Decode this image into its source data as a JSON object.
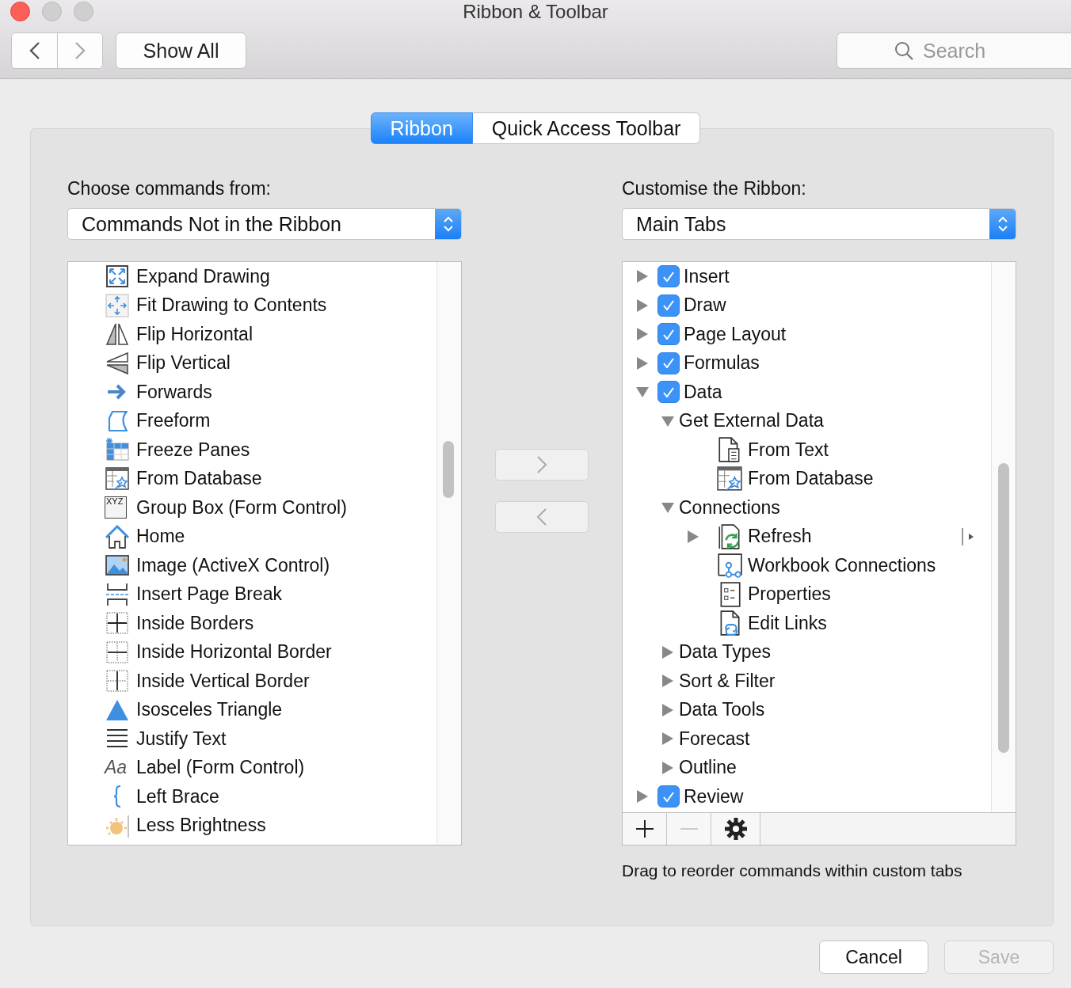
{
  "window": {
    "title": "Ribbon & Toolbar"
  },
  "toolbar": {
    "show_all": "Show All",
    "search": {
      "placeholder": "Search"
    }
  },
  "tabs": [
    {
      "label": "Ribbon",
      "selected": true
    },
    {
      "label": "Quick Access Toolbar",
      "selected": false
    }
  ],
  "left": {
    "label": "Choose commands from:",
    "dropdown": "Commands Not in the Ribbon",
    "items": [
      {
        "label": "Expand Drawing"
      },
      {
        "label": "Fit Drawing to Contents"
      },
      {
        "label": "Flip Horizontal"
      },
      {
        "label": "Flip Vertical"
      },
      {
        "label": "Forwards"
      },
      {
        "label": "Freeform"
      },
      {
        "label": "Freeze Panes"
      },
      {
        "label": "From Database"
      },
      {
        "label": "Group Box (Form Control)",
        "glyph": "XYZ"
      },
      {
        "label": "Home"
      },
      {
        "label": "Image (ActiveX Control)"
      },
      {
        "label": "Insert Page Break"
      },
      {
        "label": "Inside Borders"
      },
      {
        "label": "Inside Horizontal Border"
      },
      {
        "label": "Inside Vertical Border"
      },
      {
        "label": "Isosceles Triangle"
      },
      {
        "label": "Justify Text"
      },
      {
        "label": "Label (Form Control)",
        "glyph": "Aa"
      },
      {
        "label": "Left Brace"
      },
      {
        "label": "Less Brightness"
      }
    ]
  },
  "right": {
    "label": "Customise the Ribbon:",
    "dropdown": "Main Tabs",
    "tree": [
      {
        "kind": "tab",
        "label": "Insert",
        "checked": true,
        "expanded": false
      },
      {
        "kind": "tab",
        "label": "Draw",
        "checked": true,
        "expanded": false
      },
      {
        "kind": "tab",
        "label": "Page Layout",
        "checked": true,
        "expanded": false
      },
      {
        "kind": "tab",
        "label": "Formulas",
        "checked": true,
        "expanded": false
      },
      {
        "kind": "tab",
        "label": "Data",
        "checked": true,
        "expanded": true,
        "children": [
          {
            "kind": "group",
            "label": "Get External Data",
            "expanded": true,
            "children": [
              {
                "kind": "command",
                "label": "From Text"
              },
              {
                "kind": "command",
                "label": "From Database"
              }
            ]
          },
          {
            "kind": "group",
            "label": "Connections",
            "expanded": true,
            "children": [
              {
                "kind": "split",
                "label": "Refresh",
                "expanded": false
              },
              {
                "kind": "command",
                "label": "Workbook Connections"
              },
              {
                "kind": "command",
                "label": "Properties"
              },
              {
                "kind": "command",
                "label": "Edit Links"
              }
            ]
          },
          {
            "kind": "group",
            "label": "Data Types",
            "expanded": false
          },
          {
            "kind": "group",
            "label": "Sort & Filter",
            "expanded": false
          },
          {
            "kind": "group",
            "label": "Data Tools",
            "expanded": false
          },
          {
            "kind": "group",
            "label": "Forecast",
            "expanded": false
          },
          {
            "kind": "group",
            "label": "Outline",
            "expanded": false
          }
        ]
      },
      {
        "kind": "tab",
        "label": "Review",
        "checked": true,
        "expanded": false
      }
    ],
    "remove_disabled": true,
    "hint": "Drag to reorder commands within custom tabs"
  },
  "buttons": [
    {
      "label": "Cancel",
      "disabled": false
    },
    {
      "label": "Save",
      "disabled": true
    }
  ]
}
